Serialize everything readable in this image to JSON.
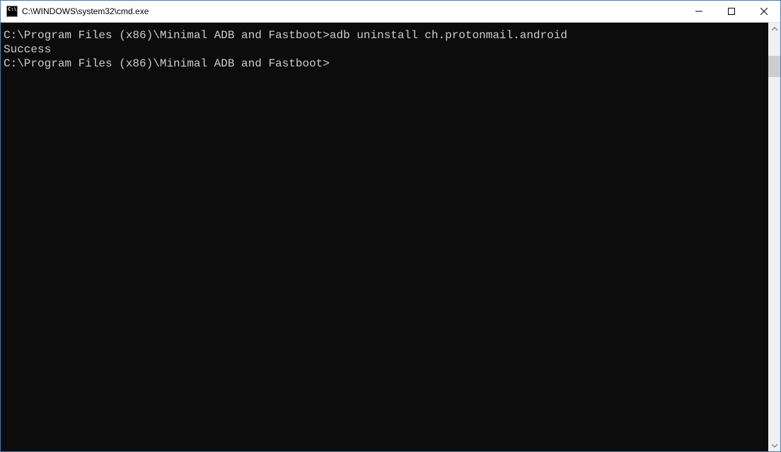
{
  "window": {
    "title": "C:\\WINDOWS\\system32\\cmd.exe"
  },
  "terminal": {
    "lines": [
      {
        "prompt": "C:\\Program Files (x86)\\Minimal ADB and Fastboot>",
        "command": "adb uninstall ch.protonmail.android"
      },
      {
        "output": "Success"
      },
      {
        "blank": ""
      },
      {
        "prompt": "C:\\Program Files (x86)\\Minimal ADB and Fastboot>",
        "command": ""
      }
    ]
  }
}
